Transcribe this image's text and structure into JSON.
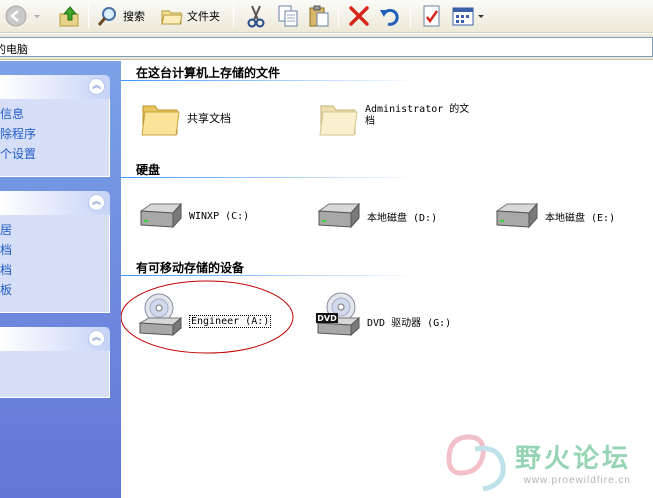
{
  "toolbar": {
    "search_label": "搜索",
    "folders_label": "文件夹"
  },
  "address": {
    "value": "我的电脑"
  },
  "left_pane": {
    "panel1_items": [
      "系统信息",
      "删除程序",
      "改一个设置"
    ],
    "panel2_items": [
      "网上邻居",
      "我的文档",
      "共享文档",
      "控制面板"
    ]
  },
  "main": {
    "sections": {
      "stored_files": "在这台计算机上存储的文件",
      "hard_disks": "硬盘",
      "removable": "有可移动存储的设备"
    },
    "files": [
      {
        "label": "共享文档",
        "icon": "folder-icon"
      },
      {
        "label_line1": "Administrator 的文",
        "label_line2": "档",
        "icon": "folder-icon"
      }
    ],
    "drives": [
      {
        "label": "WINXP (C:)",
        "icon": "hard-disk-icon"
      },
      {
        "label": "本地磁盘 (D:)",
        "icon": "hard-disk-icon"
      },
      {
        "label": "本地磁盘 (E:)",
        "icon": "hard-disk-icon"
      }
    ],
    "removable_items": [
      {
        "label": "Engineer (A:)",
        "icon": "cd-drive-icon"
      },
      {
        "label": "DVD 驱动器 (G:)",
        "icon": "dvd-drive-icon",
        "badge": "DVD"
      }
    ]
  },
  "watermark": {
    "title": "野火论坛",
    "url": "www.proewildfire.cn"
  },
  "colors": {
    "task_pane": "#6d8ee0",
    "link": "#215dc6",
    "annotation": "#c00000"
  }
}
